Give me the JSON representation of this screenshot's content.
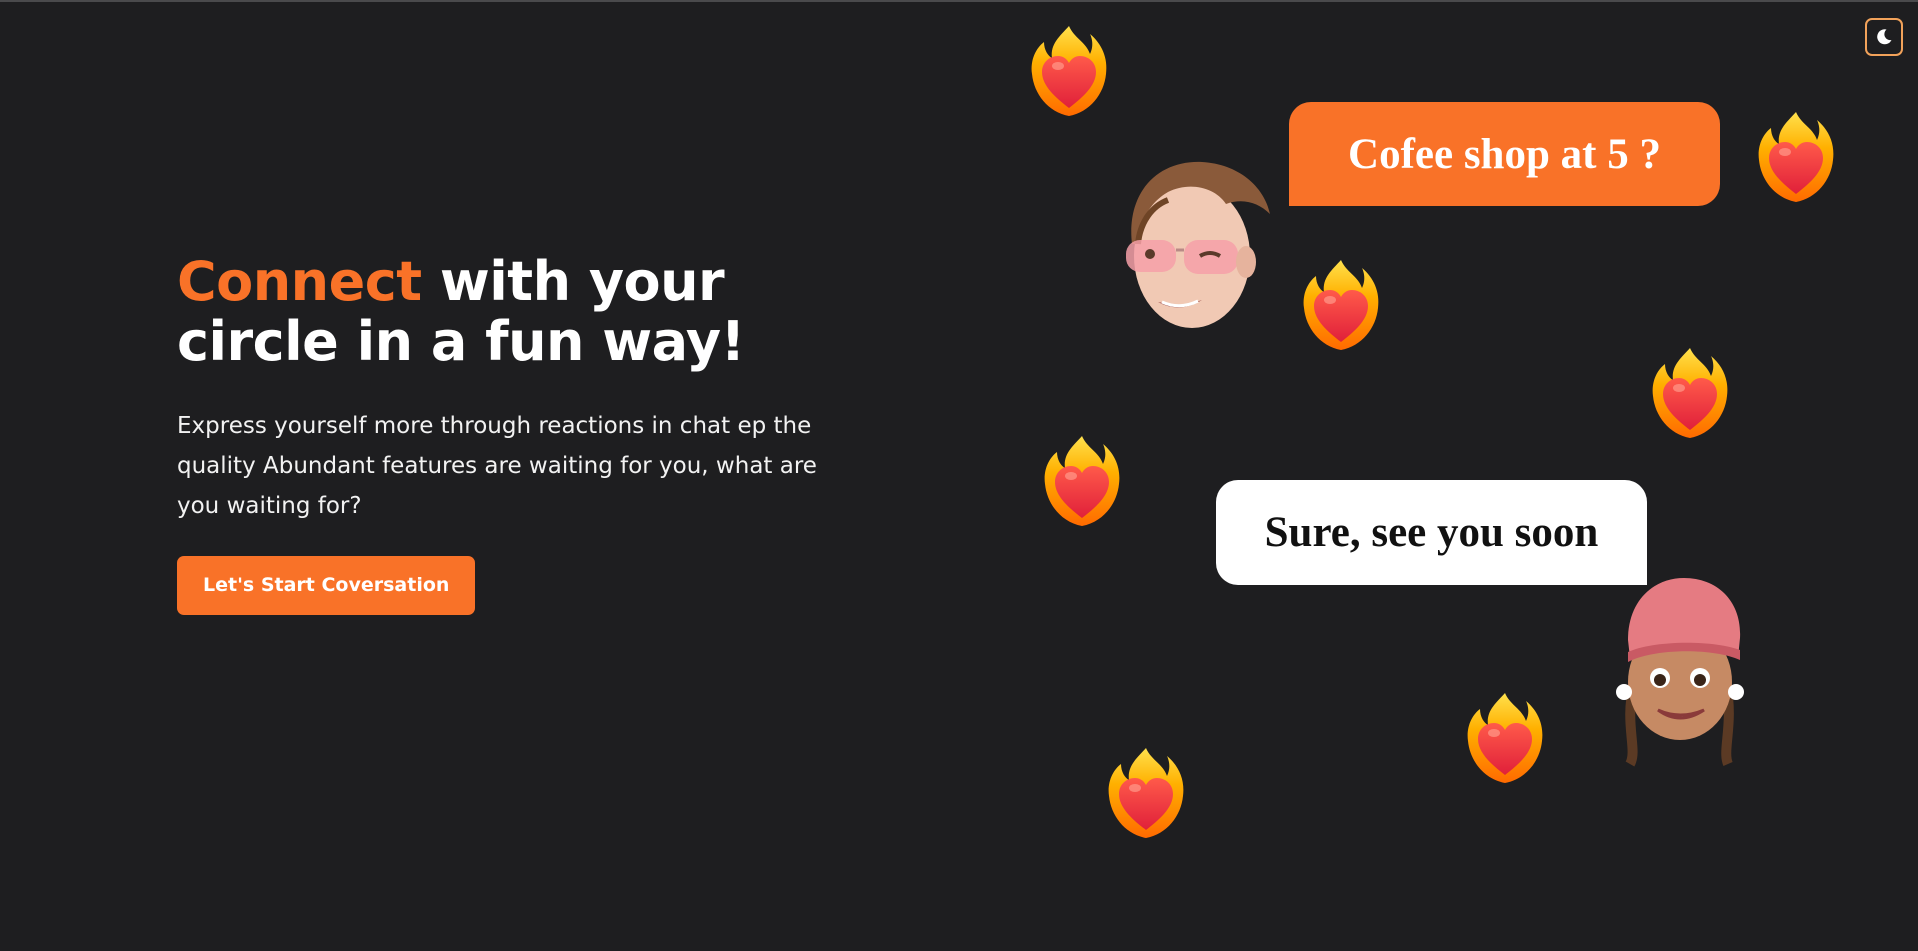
{
  "theme_toggle": {
    "icon": "moon-icon"
  },
  "hero": {
    "headline_accent": "Connect",
    "headline_rest_line1": " with your",
    "headline_line2": "circle in a fun way!",
    "description": "Express yourself more through reactions in chat ep the quality Abundant features are waiting for you, what are you waiting for?",
    "cta_label": "Let's Start Coversation"
  },
  "chat": {
    "message_1": "Cofee shop at 5 ?",
    "message_2": "Sure, see you soon"
  },
  "decorations": {
    "heart_icon": "heart-on-fire-icon",
    "avatar_1": "boy-memoji-avatar",
    "avatar_2": "girl-memoji-avatar"
  },
  "colors": {
    "accent": "#f97228",
    "background": "#1e1e20",
    "text": "#ffffff"
  }
}
